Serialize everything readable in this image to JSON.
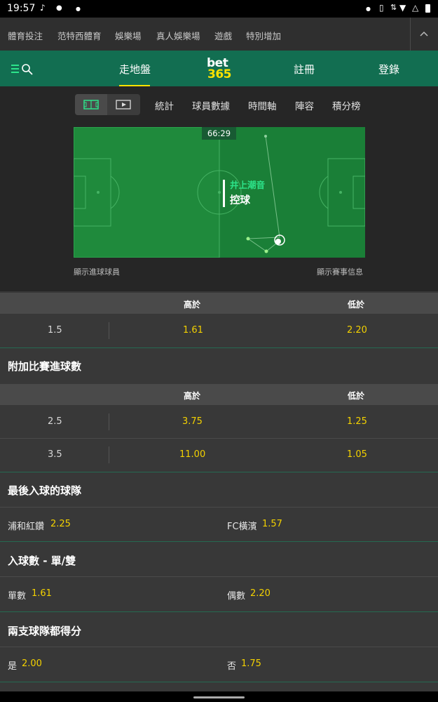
{
  "status_bar": {
    "time": "19:57",
    "left_icons": [
      "tiktok-icon",
      "line-icon",
      "dot-icon"
    ],
    "right_icons": [
      "dot-icon",
      "vibrate-icon",
      "mobile-data-icon",
      "wifi-icon",
      "warning-icon",
      "battery-icon"
    ]
  },
  "top_nav": {
    "items": [
      "體育投注",
      "范特西體育",
      "娛樂場",
      "真人娛樂場",
      "遊戲",
      "特別增加"
    ]
  },
  "header": {
    "logo_top": "bet",
    "logo_bottom": "365",
    "tabs": [
      "走地盤",
      "註冊",
      "登錄"
    ],
    "active_tab": "走地盤"
  },
  "sub_tabs": [
    "統計",
    "球員數據",
    "時間軸",
    "陣容",
    "積分榜"
  ],
  "pitch": {
    "clock": "66:29",
    "player": "井上潮音",
    "event": "控球",
    "caption_left": "顯示進球球員",
    "caption_right": "顯示賽事信息"
  },
  "goals_market": {
    "col_over": "高於",
    "col_under": "低於",
    "rows": [
      {
        "line": "1.5",
        "over": "1.61",
        "under": "2.20"
      }
    ]
  },
  "extra_goals_market": {
    "title": "附加比賽進球數",
    "col_over": "高於",
    "col_under": "低於",
    "rows": [
      {
        "line": "2.5",
        "over": "3.75",
        "under": "1.25"
      },
      {
        "line": "3.5",
        "over": "11.00",
        "under": "1.05"
      }
    ]
  },
  "last_goal_market": {
    "title": "最後入球的球隊",
    "left_name": "浦和紅鑽",
    "left_odds": "2.25",
    "right_name": "FC橫濱",
    "right_odds": "1.57"
  },
  "odd_even_market": {
    "title": "入球數 - 單/雙",
    "left_name": "單數",
    "left_odds": "1.61",
    "right_name": "偶數",
    "right_odds": "2.20"
  },
  "btts_market": {
    "title": "兩支球隊都得分",
    "left_name": "是",
    "left_odds": "2.00",
    "right_name": "否",
    "right_odds": "1.75"
  },
  "colors": {
    "brand_green": "#126e51",
    "accent_yellow": "#fde100",
    "pitch_green": "#1f8a3c",
    "odds_yellow": "#f3d100"
  }
}
